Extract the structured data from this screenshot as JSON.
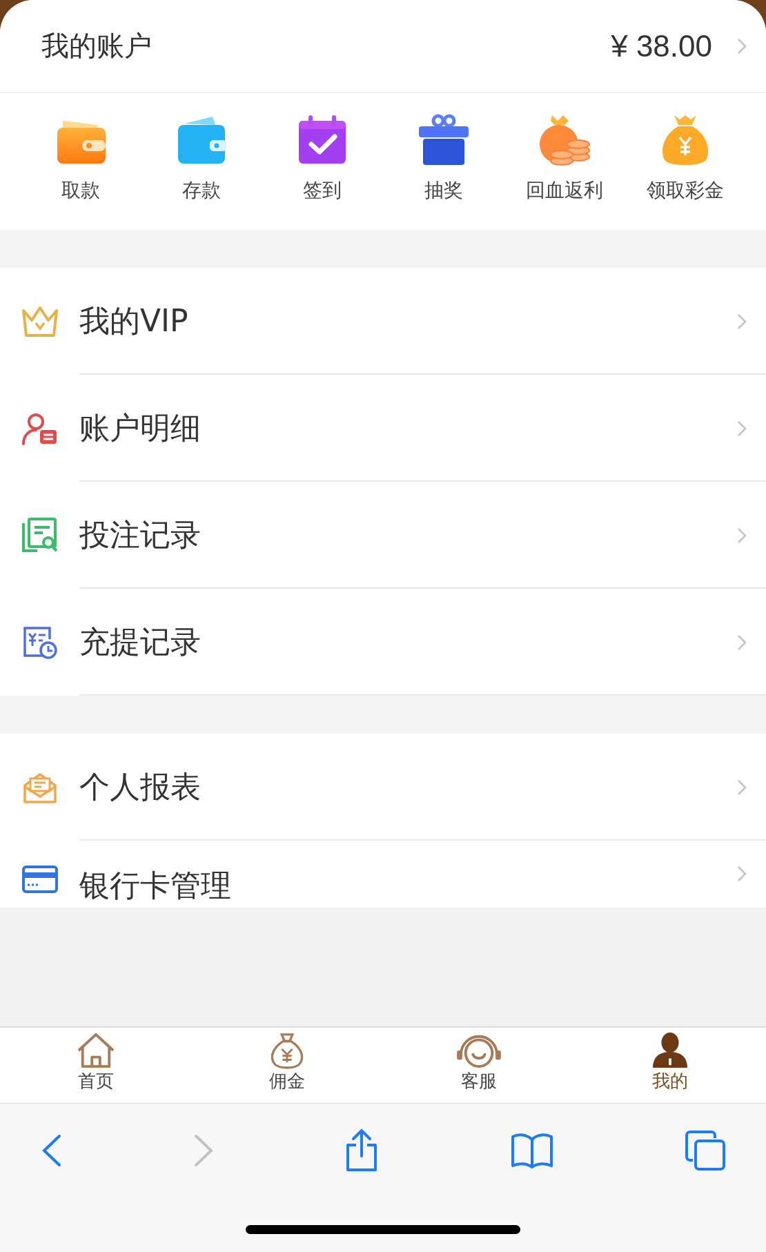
{
  "account": {
    "title": "我的账户",
    "balance": "¥ 38.00"
  },
  "quick_actions": [
    {
      "label": "取款",
      "kind": "withdraw"
    },
    {
      "label": "存款",
      "kind": "deposit"
    },
    {
      "label": "签到",
      "kind": "checkin"
    },
    {
      "label": "抽奖",
      "kind": "lottery"
    },
    {
      "label": "回血返利",
      "kind": "rebate"
    },
    {
      "label": "领取彩金",
      "kind": "bonus"
    }
  ],
  "menu_sections": [
    {
      "items": [
        {
          "label": "我的VIP",
          "kind": "vip"
        },
        {
          "label": "账户明细",
          "kind": "details"
        },
        {
          "label": "投注记录",
          "kind": "bets"
        },
        {
          "label": "充提记录",
          "kind": "transfers"
        }
      ]
    },
    {
      "items": [
        {
          "label": "个人报表",
          "kind": "report"
        },
        {
          "label": "银行卡管理",
          "kind": "card"
        }
      ]
    }
  ],
  "tab_bar": [
    {
      "label": "首页",
      "kind": "home",
      "selected": false
    },
    {
      "label": "佣金",
      "kind": "commission",
      "selected": false
    },
    {
      "label": "客服",
      "kind": "service",
      "selected": false
    },
    {
      "label": "我的",
      "kind": "me",
      "selected": true
    }
  ],
  "browser_toolbar": {
    "back_disabled": false,
    "forward_disabled": true
  }
}
